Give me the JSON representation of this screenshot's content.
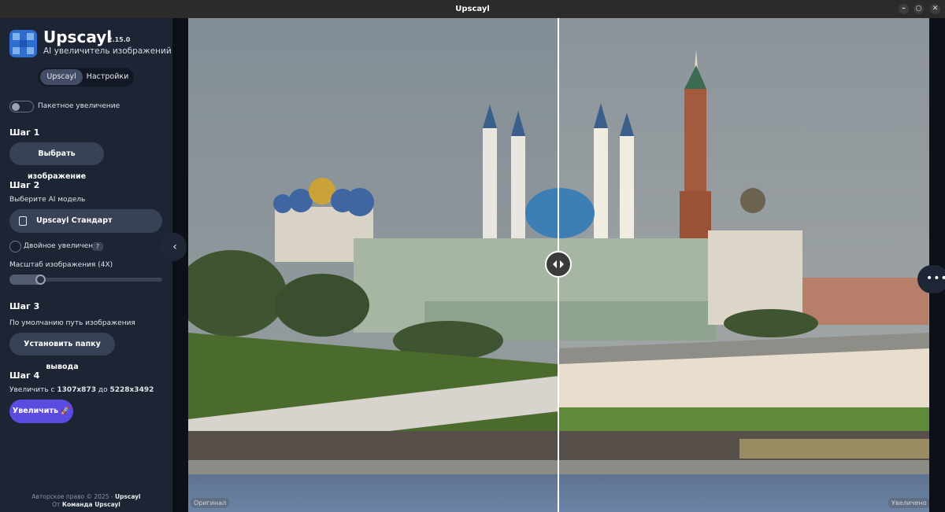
{
  "window": {
    "title": "Upscayl"
  },
  "app": {
    "name": "Upscayl",
    "version": "2.15.0",
    "subtitle": "AI увеличитель изображений"
  },
  "tabs": [
    {
      "label": "Upscayl",
      "active": true
    },
    {
      "label": "Настройки",
      "active": false
    }
  ],
  "batch": {
    "label": "Пакетное увеличение",
    "enabled": false
  },
  "step1": {
    "title": "Шаг 1",
    "button": "Выбрать изображение"
  },
  "step2": {
    "title": "Шаг 2",
    "model_label": "Выберите AI модель",
    "model_value": "Upscayl Стандарт",
    "double_label": "Двойное увеличение",
    "double_help": "?",
    "scale_label": "Масштаб изображения (4X)",
    "scale_value": 4,
    "scale_fraction": 0.2
  },
  "step3": {
    "title": "Шаг 3",
    "path_label": "По умолчанию путь изображения",
    "button": "Установить папку вывода"
  },
  "step4": {
    "title": "Шаг 4",
    "text_prefix": "Увеличить с",
    "from_size": "1307x873",
    "text_mid": "до",
    "to_size": "5228x3492",
    "button": "Увеличить 🚀"
  },
  "footer": {
    "copyright_prefix": "Авторское право © 2025 -",
    "copyright_brand": "Upscayl",
    "by_prefix": "От",
    "by_team": "Команда Upscayl"
  },
  "viewer": {
    "left_label": "Оригинал",
    "right_label": "Увеличено",
    "split_fraction": 0.5
  },
  "colors": {
    "accent": "#5c4be0",
    "sidebar_bg": "#1d2433",
    "button_bg": "#384256"
  },
  "icons": {
    "collapse": "chevron-left-icon",
    "compare_handle": "compare-arrows-icon",
    "more": "more-dots-icon",
    "model": "image-icon"
  }
}
